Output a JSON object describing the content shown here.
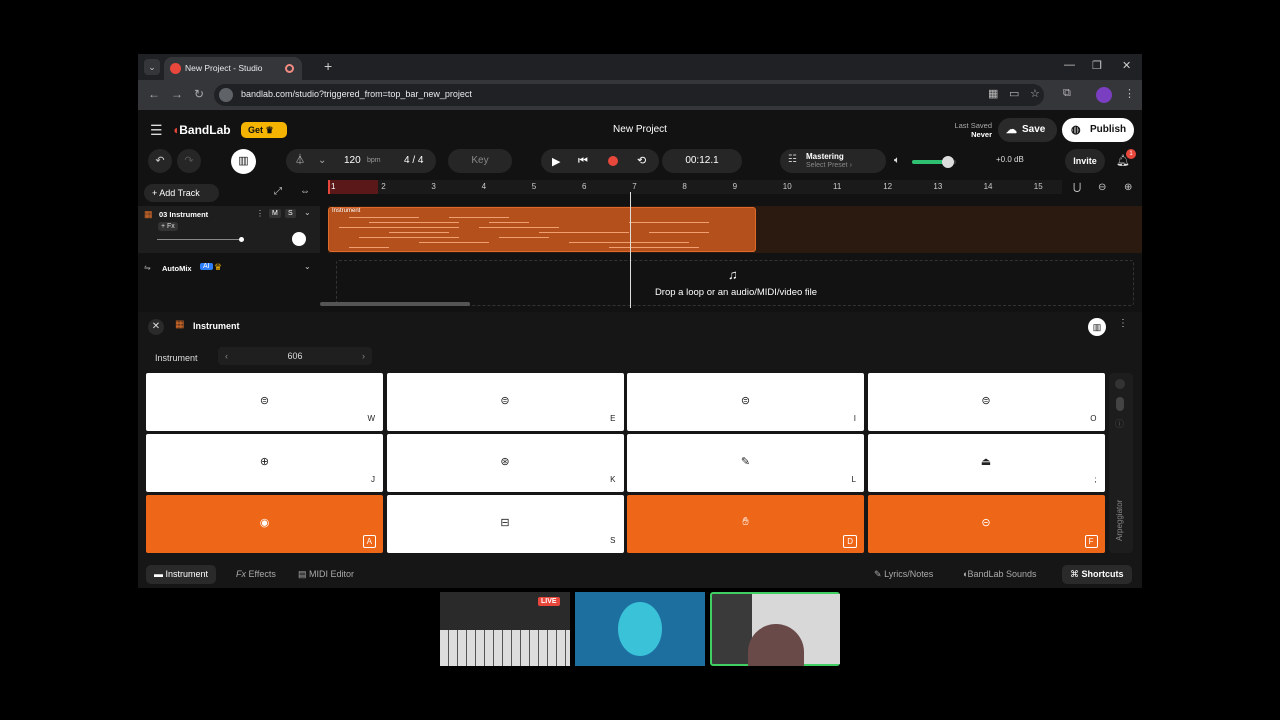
{
  "browser": {
    "tab_title": "New Project - Studio",
    "url": "bandlab.com/studio?triggered_from=top_bar_new_project"
  },
  "header": {
    "logo": "BandLab",
    "get_label": "Get",
    "title": "New Project",
    "last_saved_label": "Last Saved",
    "last_saved_value": "Never",
    "save_label": "Save",
    "publish_label": "Publish"
  },
  "transport": {
    "bpm": "120",
    "bpm_unit": "bpm",
    "time_signature": "4 / 4",
    "key_label": "Key",
    "time": "00:12.1",
    "mastering_label": "Mastering",
    "mastering_preset": "Select Preset",
    "gain": "+0.0 dB",
    "volume_fraction": 0.82,
    "invite_label": "Invite",
    "notification_count": "1"
  },
  "tracks": {
    "add_track_label": "Add Track",
    "track_name": "03 Instrument",
    "fx_label": "+ Fx",
    "mute_label": "M",
    "solo_label": "S",
    "clip_label": "Instrument",
    "automix_label": "AutoMix",
    "ai_label": "AI",
    "drop_text": "Drop a loop or an audio/MIDI/video file"
  },
  "ruler": [
    "1",
    "2",
    "3",
    "4",
    "5",
    "6",
    "7",
    "8",
    "9",
    "10",
    "11",
    "12",
    "13",
    "14",
    "15"
  ],
  "instrument_panel": {
    "title": "Instrument",
    "instrument_label": "Instrument",
    "preset_value": "606",
    "pads": [
      {
        "key": "W",
        "icon": "drum-icon",
        "active": false
      },
      {
        "key": "E",
        "icon": "drum-icon",
        "active": false
      },
      {
        "key": "I",
        "icon": "drum-icon",
        "active": false
      },
      {
        "key": "O",
        "icon": "drum-icon",
        "active": false
      },
      {
        "key": "J",
        "icon": "cymbal-icon",
        "active": false
      },
      {
        "key": "K",
        "icon": "hihat-icon",
        "active": false
      },
      {
        "key": "L",
        "icon": "shaker-icon",
        "active": false
      },
      {
        "key": ";",
        "icon": "cowbell-icon",
        "active": false
      },
      {
        "key": "A",
        "icon": "kick-icon",
        "active": true
      },
      {
        "key": "S",
        "icon": "snare-icon",
        "active": false
      },
      {
        "key": "D",
        "icon": "clap-icon",
        "active": true
      },
      {
        "key": "F",
        "icon": "tom-icon",
        "active": true
      }
    ],
    "arpeggiator_label": "Arpeggiator"
  },
  "footer": {
    "tab_instrument": "Instrument",
    "tab_effects": "Effects",
    "tab_midi_editor": "MIDI Editor",
    "lyrics_label": "Lyrics/Notes",
    "sounds_label": "BandLab Sounds",
    "shortcuts_label": "Shortcuts"
  },
  "stream": {
    "live_label": "LIVE"
  },
  "colors": {
    "accent": "#ee6617",
    "brand_red": "#e8473b",
    "get_gold": "#f5b400"
  }
}
